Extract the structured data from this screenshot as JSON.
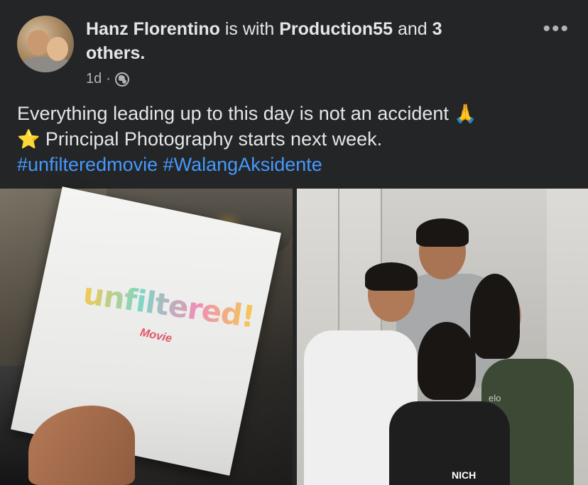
{
  "post": {
    "author": "Hanz Florentino",
    "with_text": " is with ",
    "tagged_page": "Production55",
    "and_text": " and ",
    "others_count": "3",
    "others_label": "others.",
    "time": "1d",
    "separator": "·",
    "privacy_icon": "globe-icon",
    "more_icon": "ellipsis-icon",
    "more_label": "•••"
  },
  "caption": {
    "line1": "Everything leading up to this day is not an accident",
    "line1_emoji": "🙏",
    "line2_emoji": "⭐",
    "line2": " Principal Photography starts next week.",
    "hashtags": [
      "#unfilteredmovie",
      "#WalangAksidente"
    ]
  },
  "photos": {
    "left": {
      "logo_text": "unfiltered!",
      "logo_sub": "Movie"
    },
    "right": {
      "shirt_text": "elo",
      "shirt_text2": "NICH"
    }
  },
  "colors": {
    "background": "#242526",
    "text": "#e4e6eb",
    "muted": "#b0b3b8",
    "link": "#4599ff"
  }
}
